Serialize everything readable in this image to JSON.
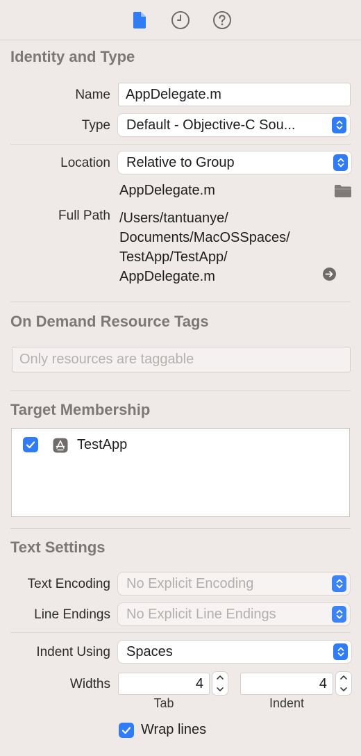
{
  "tabs": [
    {
      "name": "file-inspector",
      "icon": "document-icon",
      "active": true
    },
    {
      "name": "history-inspector",
      "icon": "clock-icon",
      "active": false
    },
    {
      "name": "quick-help",
      "icon": "question-icon",
      "active": false
    }
  ],
  "identity": {
    "title": "Identity and Type",
    "name_label": "Name",
    "name_value": "AppDelegate.m",
    "type_label": "Type",
    "type_value": "Default - Objective-C Sou...",
    "location_label": "Location",
    "location_value": "Relative to Group",
    "file_name": "AppDelegate.m",
    "full_path_label": "Full Path",
    "full_path_lines": [
      "/Users/tantuanye/",
      "Documents/MacOSSpaces/",
      "TestApp/TestApp/",
      "AppDelegate.m"
    ]
  },
  "on_demand": {
    "title": "On Demand Resource Tags",
    "placeholder": "Only resources are taggable"
  },
  "target_membership": {
    "title": "Target Membership",
    "targets": [
      {
        "label": "TestApp",
        "checked": true,
        "icon": "app-target-icon"
      }
    ]
  },
  "text_settings": {
    "title": "Text Settings",
    "encoding_label": "Text Encoding",
    "encoding_value": "No Explicit Encoding",
    "line_endings_label": "Line Endings",
    "line_endings_value": "No Explicit Line Endings",
    "indent_using_label": "Indent Using",
    "indent_using_value": "Spaces",
    "widths_label": "Widths",
    "tab_width": "4",
    "indent_width": "4",
    "tab_caption": "Tab",
    "indent_caption": "Indent",
    "wrap_lines_label": "Wrap lines",
    "wrap_lines_checked": true
  },
  "colors": {
    "accent": "#2f7cf6",
    "background": "#efeae7",
    "section_title": "#7b7876"
  }
}
